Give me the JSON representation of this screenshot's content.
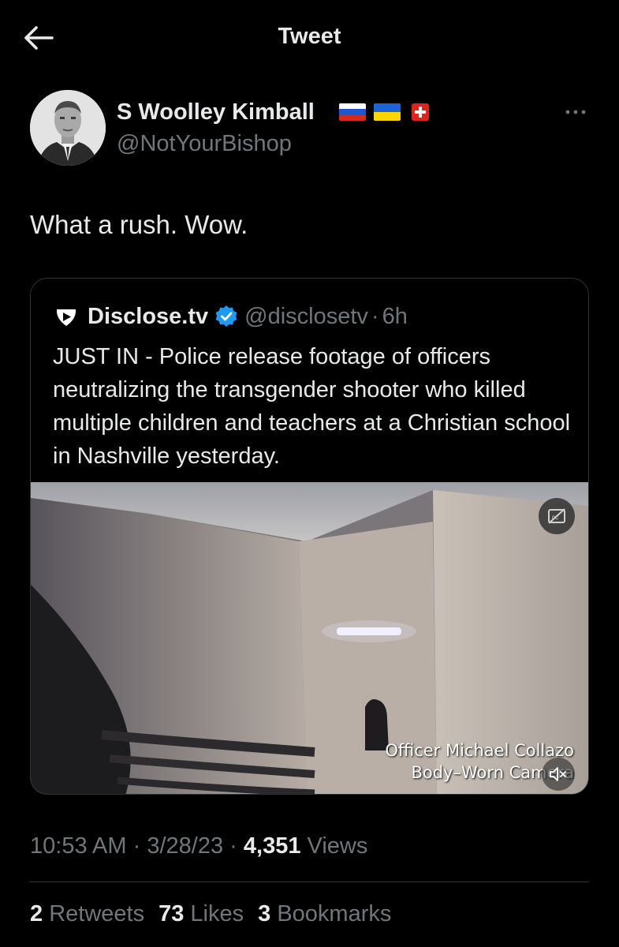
{
  "header": {
    "title": "Tweet",
    "back_icon": "arrow-left-icon"
  },
  "author": {
    "name": "S Woolley Kimball",
    "handle": "@NotYourBishop",
    "flags": [
      "russia-flag-icon",
      "ukraine-flag-icon",
      "switzerland-flag-icon"
    ]
  },
  "tweet": {
    "text": "What a rush. Wow."
  },
  "quote": {
    "name": "Disclose.tv",
    "handle": "@disclosetv",
    "separator": "·",
    "time": "6h",
    "text": "JUST IN - Police release footage of officers neutralizing the transgender shooter who killed multiple children and teachers at a Christian school in Nashville yesterday.",
    "media": {
      "caption_line1": "Officer Michael Collazo",
      "caption_line2": "Body–Worn Camera"
    }
  },
  "meta": {
    "time": "10:53 AM",
    "sep1": "·",
    "date": "3/28/23",
    "sep2": "·",
    "views_count": "4,351",
    "views_label": "Views"
  },
  "stats": {
    "retweets_count": "2",
    "retweets_label": "Retweets",
    "likes_count": "73",
    "likes_label": "Likes",
    "bookmarks_count": "3",
    "bookmarks_label": "Bookmarks"
  },
  "colors": {
    "background": "#000000",
    "text": "#e7e9ea",
    "muted": "#71767b",
    "border": "#2f3336",
    "verified": "#1d9bf0"
  }
}
